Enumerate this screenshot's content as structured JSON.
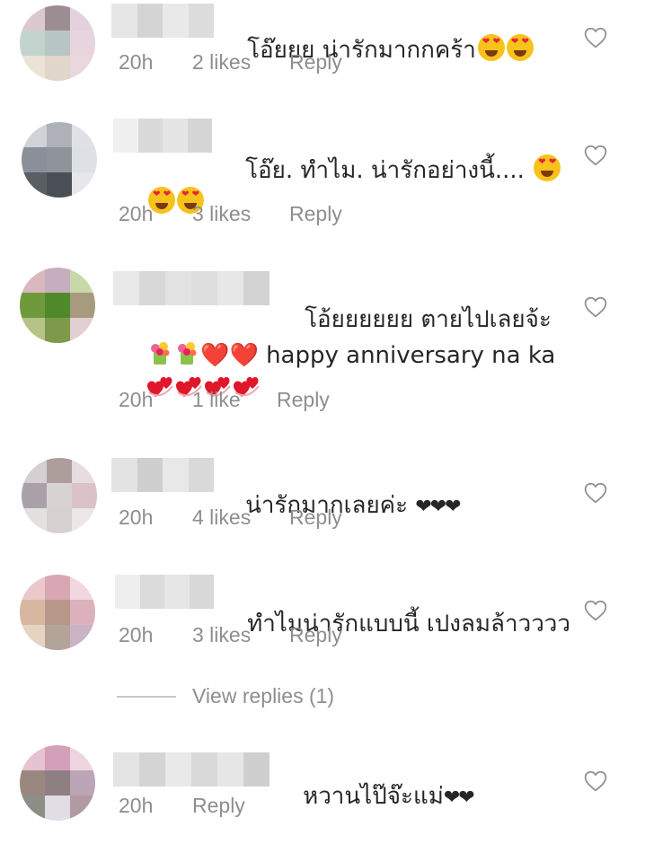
{
  "comments": [
    {
      "text_parts": [
        "โอ๊ยยย น่ารักมากกคร้า",
        "",
        ""
      ],
      "time": "20h",
      "likes": "2 likes",
      "reply": "Reply"
    },
    {
      "text_line1": "โอ๊ย. ทำไม. น่ารักอย่างนี้....",
      "time": "20h",
      "likes": "3 likes",
      "reply": "Reply"
    },
    {
      "text_line1": "โอ้ยยยยยย ตายไปเลยจ้ะ",
      "text_line2": "happy anniversary na ka",
      "time": "20h",
      "likes": "1 like",
      "reply": "Reply"
    },
    {
      "text": "น่ารักมากเลยค่ะ",
      "hearts": "❤❤❤",
      "time": "20h",
      "likes": "4 likes",
      "reply": "Reply"
    },
    {
      "text": "ทำไมน่ารักแบบนี้ เปงลมล้าวววว",
      "time": "20h",
      "likes": "3 likes",
      "reply": "Reply"
    },
    {
      "text": "หวานไป๊จ๊ะแม่",
      "hearts": "❤❤",
      "time": "20h",
      "reply": "Reply"
    }
  ],
  "view_replies": "View replies (1)",
  "colors": {
    "text": "#262626",
    "meta": "#8e8e8e",
    "heart_red": "#e0162b"
  }
}
